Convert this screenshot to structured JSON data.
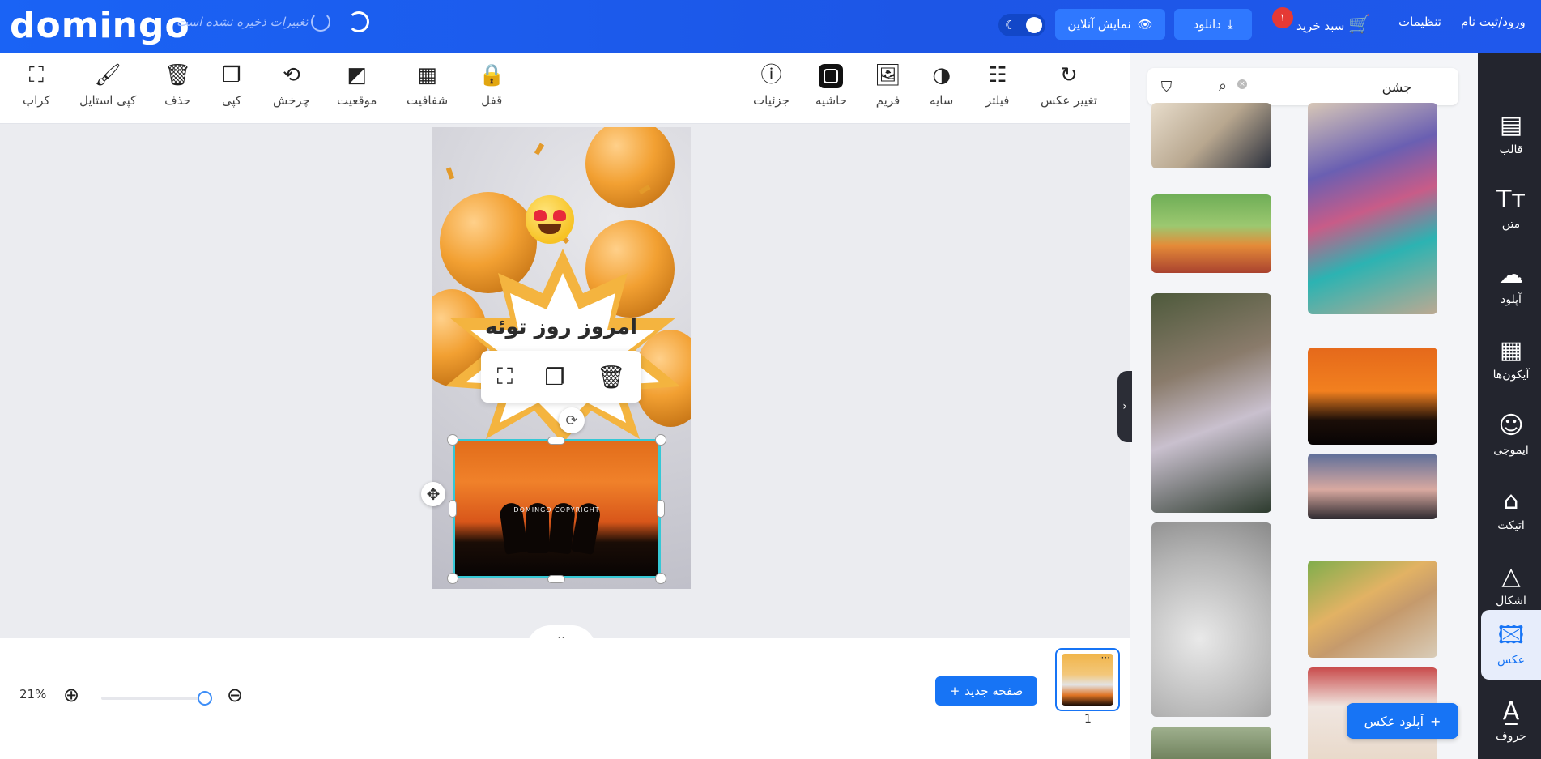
{
  "app": {
    "logo": "domingo",
    "save_status": "تغییرات ذخیره نشده است"
  },
  "header": {
    "online_preview_label": "نمایش آنلاین",
    "download_label": "دانلود",
    "cart_label": "سبد خرید",
    "cart_count": "۱",
    "settings_label": "تنظیمات",
    "login_label": "ورود/ثبت نام"
  },
  "toolbar": {
    "left_tools": [
      {
        "label": "کراپ",
        "icon": "crop-icon"
      },
      {
        "label": "کپی استایل",
        "icon": "paint-roller-icon"
      },
      {
        "label": "حذف",
        "icon": "trash-icon"
      },
      {
        "label": "کپی",
        "icon": "copy-icon"
      },
      {
        "label": "چرخش",
        "icon": "rotate-icon"
      },
      {
        "label": "موقعیت",
        "icon": "layers-icon"
      },
      {
        "label": "شفافیت",
        "icon": "checkerboard-icon"
      },
      {
        "label": "قفل",
        "icon": "lock-icon"
      }
    ],
    "right_tools": [
      {
        "label": "جزئیات",
        "icon": "info-icon"
      },
      {
        "label": "حاشیه",
        "icon": "border-icon"
      },
      {
        "label": "فریم",
        "icon": "frame-icon"
      },
      {
        "label": "سایه",
        "icon": "shadow-icon"
      },
      {
        "label": "فیلتر",
        "icon": "sliders-icon"
      },
      {
        "label": "تغییر عکس",
        "icon": "refresh-icon"
      }
    ]
  },
  "canvas": {
    "headline": "امروز روز توئه",
    "watermark": "DOMINGO COPYRIGHT"
  },
  "bottom": {
    "zoom_level": "21%",
    "new_page_label": "صفحه جدید",
    "page_number": "1"
  },
  "right_panel": {
    "search_value": "جشن",
    "upload_photo_label": "آپلود عکس"
  },
  "sidebar": {
    "items": [
      {
        "label": "قالب",
        "icon": "template-icon"
      },
      {
        "label": "متن",
        "icon": "text-icon"
      },
      {
        "label": "آپلود",
        "icon": "upload-cloud-icon"
      },
      {
        "label": "آیکون‌ها",
        "icon": "grid-icon"
      },
      {
        "label": "ایموجی",
        "icon": "smiley-icon"
      },
      {
        "label": "اتیکت",
        "icon": "tag-icon"
      },
      {
        "label": "اشکال",
        "icon": "triangle-icon"
      },
      {
        "label": "عکس",
        "icon": "image-icon"
      },
      {
        "label": "حروف",
        "icon": "letter-a-icon"
      }
    ]
  },
  "colors": {
    "brand_blue": "#1774f5",
    "selection_cyan": "#35c8d6",
    "sidebar_dark": "#23252e"
  }
}
